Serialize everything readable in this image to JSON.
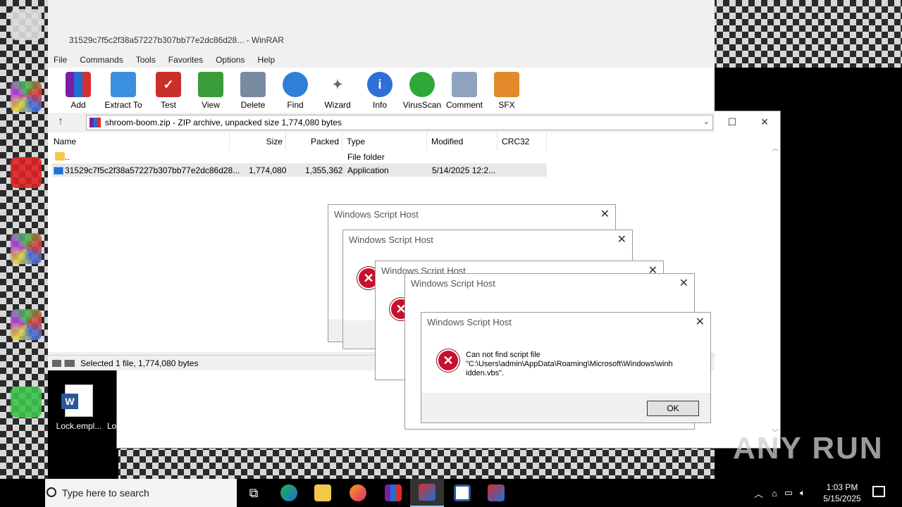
{
  "winrar": {
    "title": "31529c7f5c2f38a57227b307bb77e2dc86d28... - WinRAR",
    "menu": [
      "File",
      "Commands",
      "Tools",
      "Favorites",
      "Options",
      "Help"
    ],
    "toolbar": [
      "Add",
      "Extract To",
      "Test",
      "View",
      "Delete",
      "Find",
      "Wizard",
      "Info",
      "VirusScan",
      "Comment",
      "SFX"
    ],
    "address": "shroom-boom.zip - ZIP archive, unpacked size 1,774,080 bytes",
    "columns": [
      "Name",
      "Size",
      "Packed",
      "Type",
      "Modified",
      "CRC32"
    ],
    "rows": [
      {
        "name": "..",
        "size": "",
        "packed": "",
        "type": "File folder",
        "modified": "",
        "crc": ""
      },
      {
        "name": "31529c7f5c2f38a57227b307bb77e2dc86d28...",
        "size": "1,774,080",
        "packed": "1,355,362",
        "type": "Application",
        "modified": "5/14/2025 12:2...",
        "crc": ""
      }
    ],
    "status": "Selected 1 file, 1,774,080 bytes"
  },
  "dialogs": {
    "title": "Windows Script Host",
    "message_line1": "Can not find script file",
    "message_line2": "\"C:\\Users\\admin\\AppData\\Roaming\\Microsoft\\Windows\\winh",
    "message_line3": "idden.vbs\".",
    "ok_label": "OK"
  },
  "desktop": {
    "word_icon_label": "Lock.empl...",
    "word_icon_label2": "Lo"
  },
  "taskbar": {
    "search_placeholder": "Type here to search",
    "time": "1:03 PM",
    "date": "5/15/2025"
  },
  "watermark": "ANY RUN"
}
